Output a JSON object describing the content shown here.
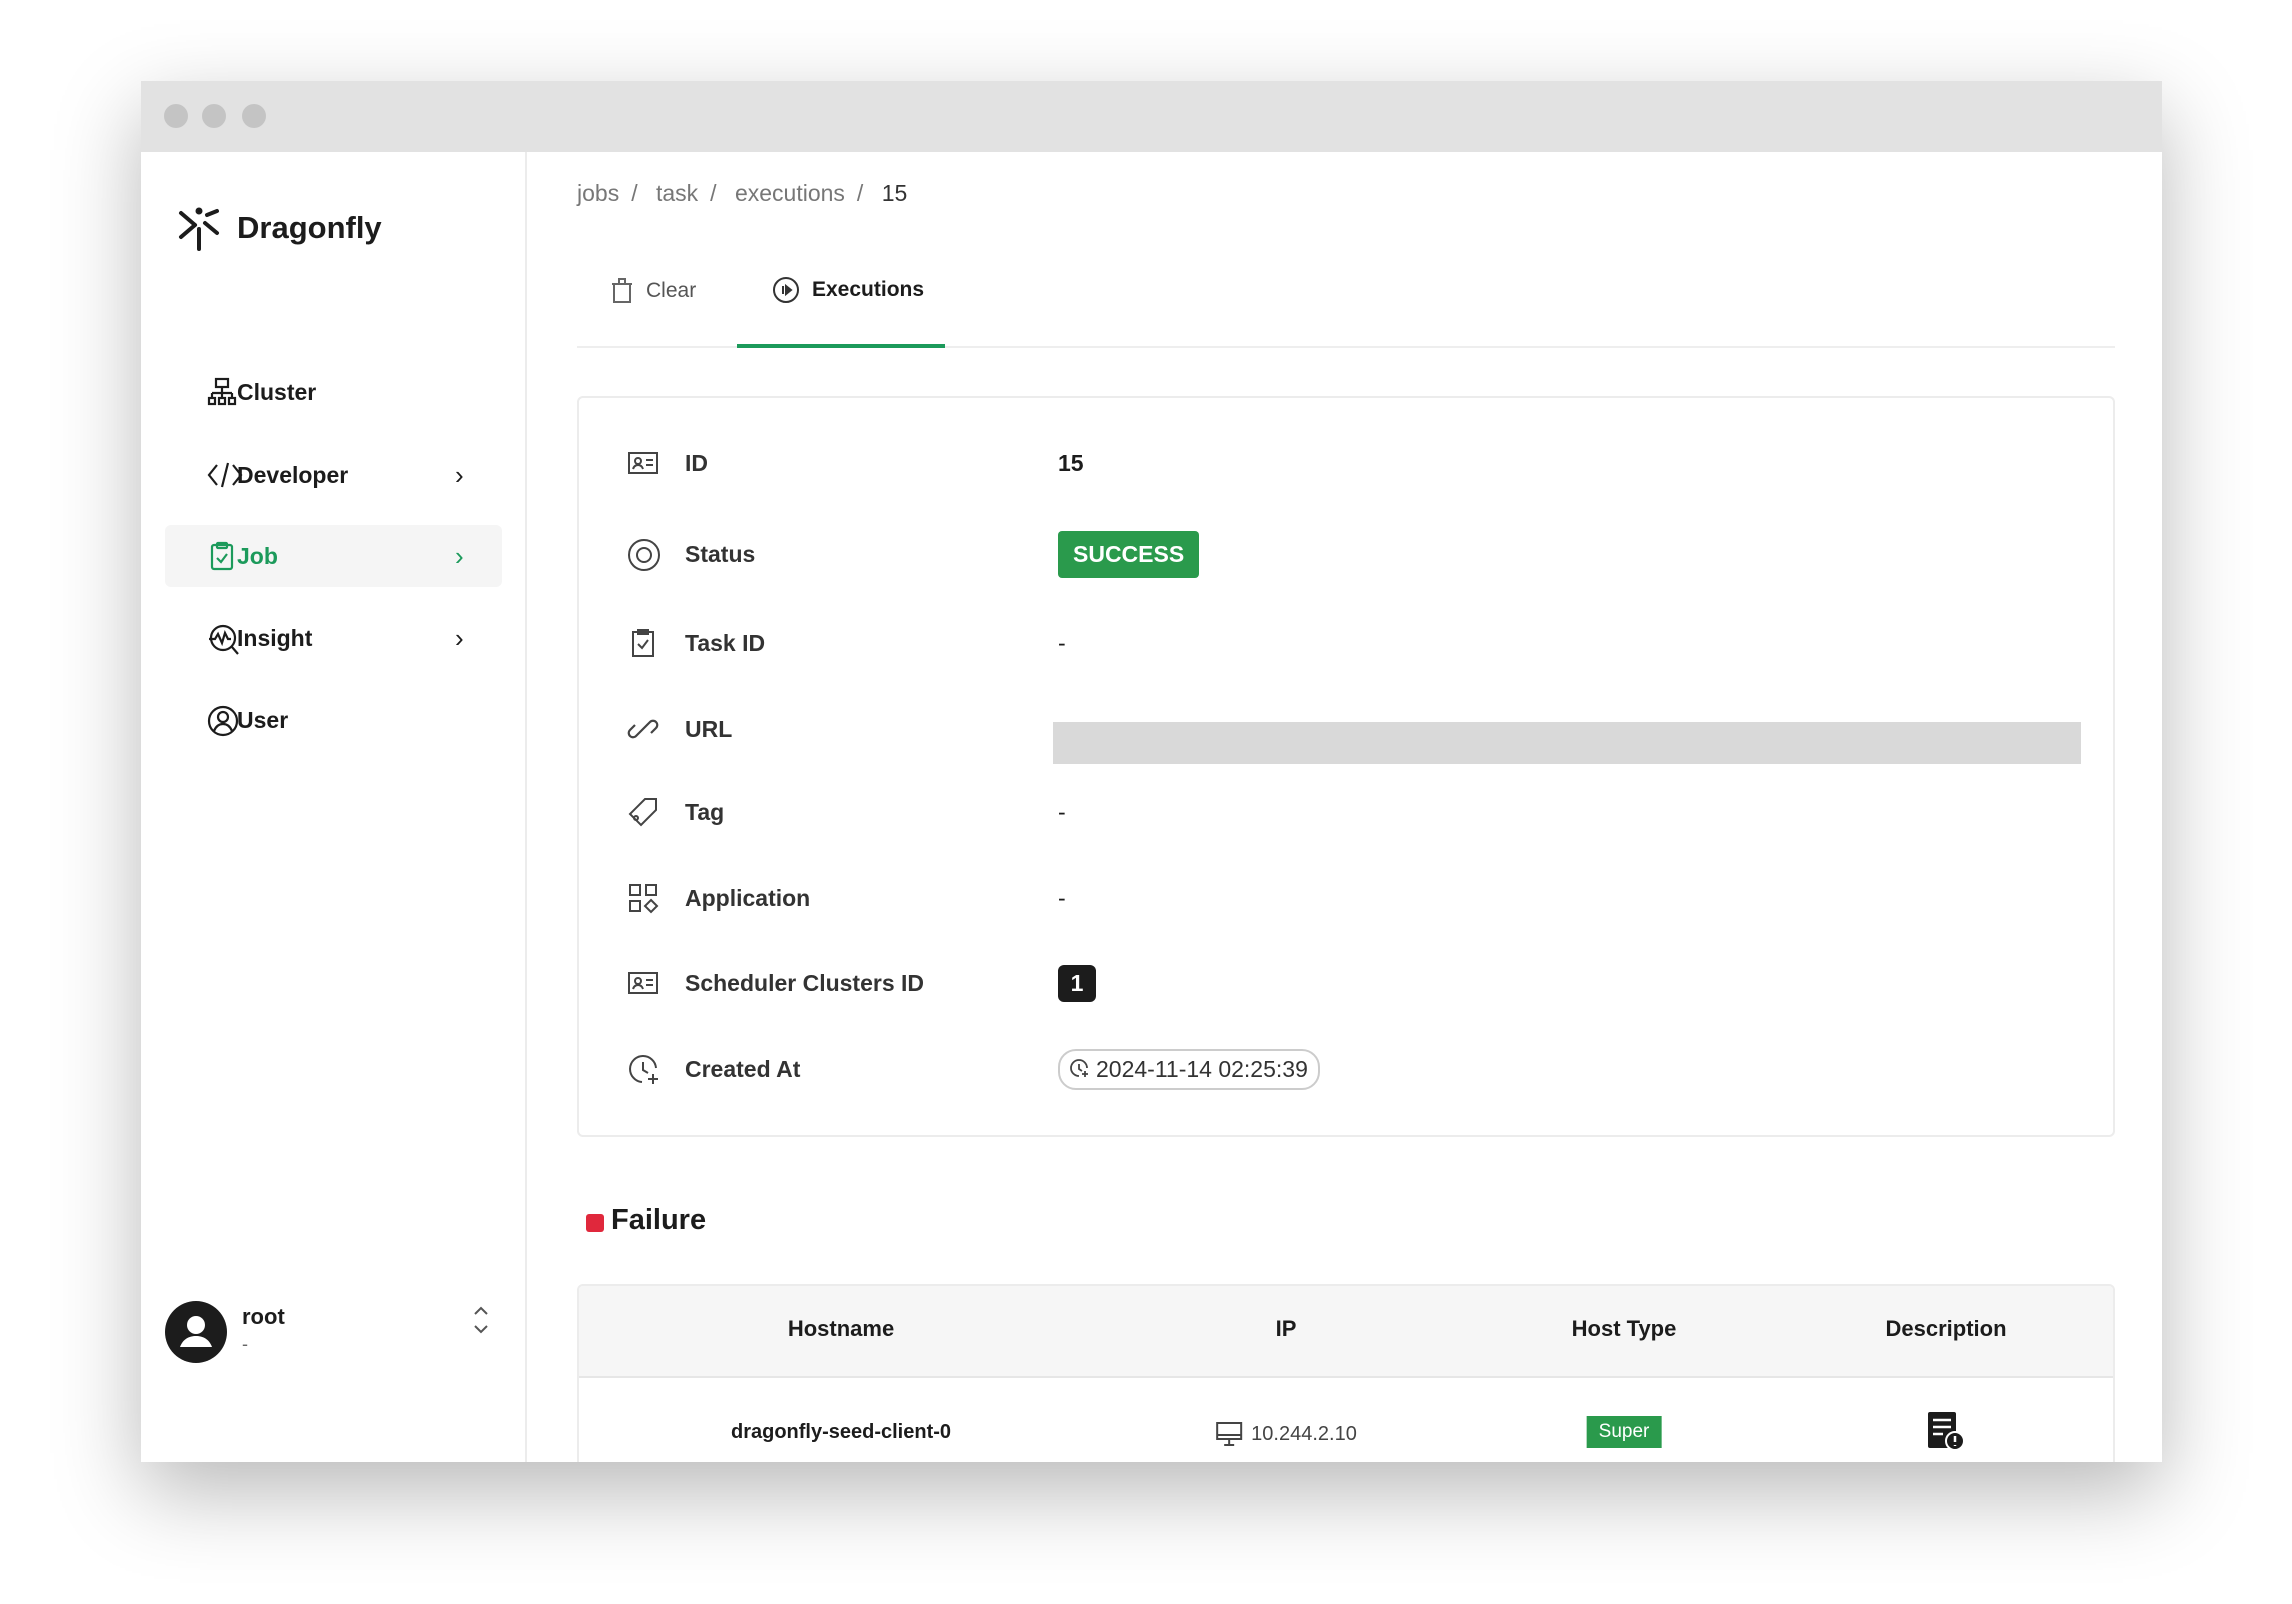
{
  "app": {
    "name": "Dragonfly"
  },
  "sidebar": {
    "items": [
      {
        "label": "Cluster",
        "icon": "cluster-icon"
      },
      {
        "label": "Developer",
        "icon": "code-icon",
        "chevron": true
      },
      {
        "label": "Job",
        "icon": "clipboard-check-icon",
        "chevron": true,
        "active": true
      },
      {
        "label": "Insight",
        "icon": "insight-icon",
        "chevron": true
      },
      {
        "label": "User",
        "icon": "user-icon"
      }
    ],
    "user": {
      "name": "root",
      "subtitle": "-"
    }
  },
  "breadcrumb": [
    "jobs",
    "task",
    "executions",
    "15"
  ],
  "tabs": [
    {
      "label": "Clear",
      "icon": "trash-icon"
    },
    {
      "label": "Executions",
      "icon": "play-circle-icon",
      "active": true
    }
  ],
  "details": {
    "id": {
      "label": "ID",
      "value": "15"
    },
    "status": {
      "label": "Status",
      "value": "SUCCESS"
    },
    "task_id": {
      "label": "Task ID",
      "value": "-"
    },
    "url": {
      "label": "URL",
      "value": ""
    },
    "tag": {
      "label": "Tag",
      "value": "-"
    },
    "application": {
      "label": "Application",
      "value": "-"
    },
    "scheduler_clusters_id": {
      "label": "Scheduler Clusters ID",
      "value": "1"
    },
    "created_at": {
      "label": "Created At",
      "value": "2024-11-14 02:25:39"
    }
  },
  "failure": {
    "title": "Failure",
    "columns": [
      "Hostname",
      "IP",
      "Host Type",
      "Description"
    ],
    "rows": [
      {
        "hostname": "dragonfly-seed-client-0",
        "ip": "10.244.2.10",
        "host_type": "Super"
      }
    ]
  },
  "colors": {
    "accent": "#1c9a5b",
    "success": "#2a9a4c",
    "failure": "#e0283c"
  }
}
